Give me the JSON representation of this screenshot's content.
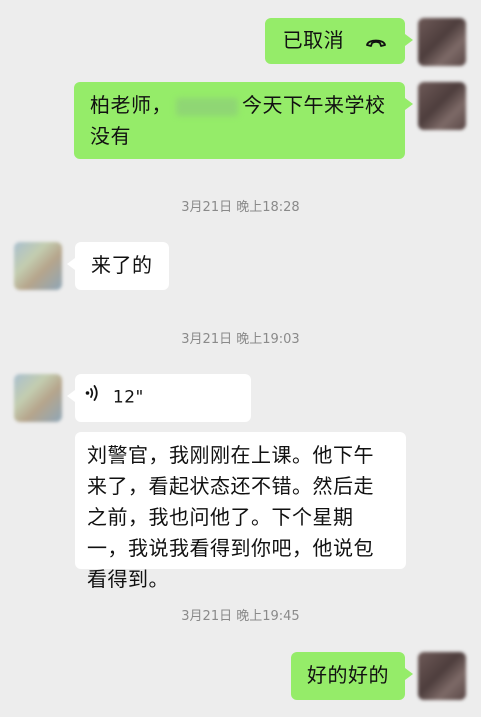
{
  "messages": [
    {
      "type": "call",
      "side": "right",
      "text": "已取消",
      "icon": "hangup-phone-icon"
    },
    {
      "type": "text",
      "side": "right",
      "prefix": "柏老师，",
      "suffix": "今天下午来学校没有"
    },
    {
      "type": "timestamp",
      "text": "3月21日 晚上18:28"
    },
    {
      "type": "text",
      "side": "left",
      "text": "来了的"
    },
    {
      "type": "timestamp",
      "text": "3月21日 晚上19:03"
    },
    {
      "type": "voice",
      "side": "left",
      "duration": "12\"",
      "icon": "voice-wave-icon"
    },
    {
      "type": "text",
      "side": "left",
      "text": "刘警官，我刚刚在上课。他下午来了，看起状态还不错。然后走之前，我也问他了。下个星期一，我说我看得到你吧，他说包看得到。"
    },
    {
      "type": "timestamp",
      "text": "3月21日 晚上19:45"
    },
    {
      "type": "text",
      "side": "right",
      "text": "好的好的"
    }
  ],
  "colors": {
    "background": "#ededed",
    "bubble_self": "#95ec69",
    "bubble_other": "#ffffff",
    "timestamp_text": "#8a8a8a"
  }
}
